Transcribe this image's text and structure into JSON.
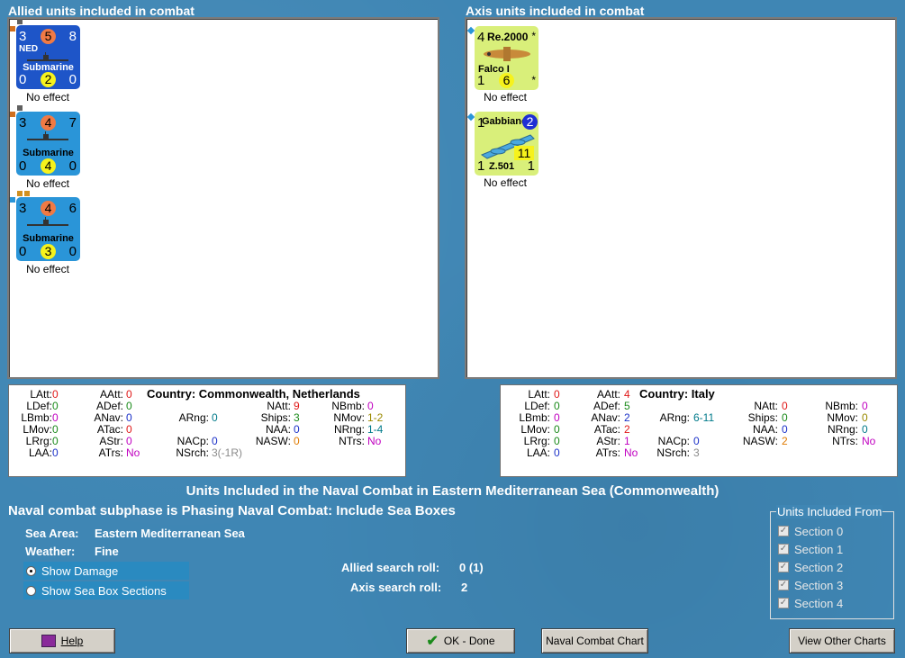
{
  "allied": {
    "header": "Allied units included in combat",
    "units": [
      {
        "tl": "3",
        "tm": "5",
        "tr": "8",
        "nation": "NED",
        "name": "Submarine",
        "bl": "0",
        "bm": "2",
        "br": "0",
        "effect": "No effect"
      },
      {
        "tl": "3",
        "tm": "4",
        "tr": "7",
        "nation": "",
        "name": "Submarine",
        "bl": "0",
        "bm": "4",
        "br": "0",
        "effect": "No effect"
      },
      {
        "tl": "3",
        "tm": "4",
        "tr": "6",
        "nation": "",
        "name": "Submarine",
        "bl": "0",
        "bm": "3",
        "br": "0",
        "effect": "No effect"
      }
    ],
    "stats": {
      "latt_l": "LAtt:",
      "latt": "0",
      "ldef_l": "LDef:",
      "ldef": "0",
      "lbmb_l": "LBmb:",
      "lbmb": "0",
      "lmov_l": "LMov:",
      "lmov": "0",
      "lrng_l": "LRrg:",
      "lrng": "0",
      "laa_l": "LAA:",
      "laa": "0",
      "aatt_l": "AAtt:",
      "aatt": "0",
      "adef_l": "ADef:",
      "adef": "0",
      "anav_l": "ANav:",
      "anav": "0",
      "atac_l": "ATac:",
      "atac": "0",
      "astr_l": "AStr:",
      "astr": "0",
      "atrs_l": "ATrs:",
      "atrs": "No",
      "country": "Country: Commonwealth, Netherlands",
      "arng_l": "ARng:",
      "arng": "0",
      "nacp_l": "NACp:",
      "nacp": "0",
      "nsrch_l": "NSrch:",
      "nsrch": "3(-1R)",
      "natt_l": "NAtt:",
      "natt": "9",
      "ships_l": "Ships:",
      "ships": "3",
      "naa_l": "NAA:",
      "naa": "0",
      "nasw_l": "NASW:",
      "nasw": "0",
      "nbmb_l": "NBmb:",
      "nbmb": "0",
      "nmov_l": "NMov:",
      "nmov": "1-2",
      "nrng_l": "NRng:",
      "nrng": "1-4",
      "ntrs_l": "NTrs:",
      "ntrs": "No"
    }
  },
  "axis": {
    "header": "Axis units included in combat",
    "units": [
      {
        "tl": "4",
        "type": "Re.2000",
        "star": "*",
        "name": "Falco I",
        "bl": "1",
        "bm": "6",
        "br": "*",
        "effect": "No effect"
      },
      {
        "tl": "1",
        "type": "Gabbiano",
        "badge": "2",
        "name": "Z.501",
        "bl": "1",
        "bm": "11",
        "br": "1",
        "effect": "No effect"
      }
    ],
    "stats": {
      "latt_l": "LAtt:",
      "latt": "0",
      "ldef_l": "LDef:",
      "ldef": "0",
      "lbmb_l": "LBmb:",
      "lbmb": "0",
      "lmov_l": "LMov:",
      "lmov": "0",
      "lrng_l": "LRrg:",
      "lrng": "0",
      "laa_l": "LAA:",
      "laa": "0",
      "aatt_l": "AAtt:",
      "aatt": "4",
      "adef_l": "ADef:",
      "adef": "5",
      "anav_l": "ANav:",
      "anav": "2",
      "atac_l": "ATac:",
      "atac": "2",
      "astr_l": "AStr:",
      "astr": "1",
      "atrs_l": "ATrs:",
      "atrs": "No",
      "country": "Country: Italy",
      "arng_l": "ARng:",
      "arng": "6-11",
      "nacp_l": "NACp:",
      "nacp": "0",
      "nsrch_l": "NSrch:",
      "nsrch": "3",
      "natt_l": "NAtt:",
      "natt": "0",
      "ships_l": "Ships:",
      "ships": "0",
      "naa_l": "NAA:",
      "naa": "0",
      "nasw_l": "NASW:",
      "nasw": "2",
      "nbmb_l": "NBmb:",
      "nbmb": "0",
      "nmov_l": "NMov:",
      "nmov": "0",
      "nrng_l": "NRng:",
      "nrng": "0",
      "ntrs_l": "NTrs:",
      "ntrs": "No"
    }
  },
  "main": {
    "title": "Units Included in the Naval Combat in Eastern Mediterranean Sea (Commonwealth)",
    "subphase": "Naval combat subphase is Phasing Naval Combat: Include Sea Boxes",
    "sea_area_label": "Sea Area:",
    "sea_area": "Eastern Mediterranean Sea",
    "weather_label": "Weather:",
    "weather": "Fine",
    "show_damage": "Show Damage",
    "show_sections": "Show Sea Box Sections",
    "allied_roll_label": "Allied search roll:",
    "allied_roll": "0 (1)",
    "axis_roll_label": "Axis search roll:",
    "axis_roll": "2"
  },
  "sections": {
    "title": "Units Included From",
    "items": [
      "Section 0",
      "Section 1",
      "Section 2",
      "Section 3",
      "Section 4"
    ]
  },
  "buttons": {
    "help": "Help",
    "ok": "OK - Done",
    "chart": "Naval Combat Chart",
    "other": "View Other Charts"
  },
  "colors": {
    "background": "#3f86b4",
    "counter_dark_blue": "#1e55c8",
    "counter_blue": "#2a95d8",
    "counter_green": "#d9ef7a",
    "circle_orange": "#f07a45",
    "circle_yellow": "#f6f21c"
  }
}
